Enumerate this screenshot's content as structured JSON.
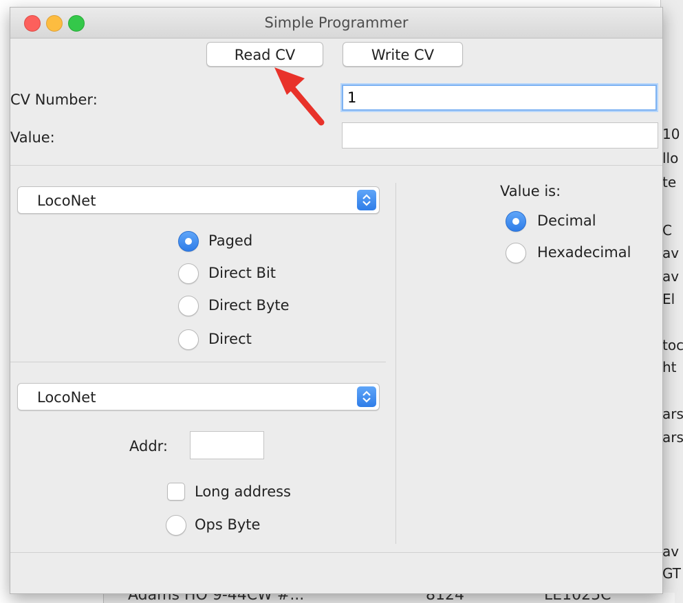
{
  "window": {
    "title": "Simple Programmer"
  },
  "toolbar": {
    "read_cv_label": "Read CV",
    "write_cv_label": "Write CV"
  },
  "cv_number": {
    "label": "CV Number:",
    "value": "1"
  },
  "value_field": {
    "label": "Value:",
    "value": ""
  },
  "programmer_select": {
    "selected": "LocoNet"
  },
  "programming_modes": [
    {
      "label": "Paged",
      "selected": true
    },
    {
      "label": "Direct Bit",
      "selected": false
    },
    {
      "label": "Direct Byte",
      "selected": false
    },
    {
      "label": "Direct",
      "selected": false
    }
  ],
  "ops_select": {
    "selected": "LocoNet"
  },
  "addr": {
    "label": "Addr:",
    "value": ""
  },
  "long_address": {
    "label": "Long address",
    "checked": false
  },
  "ops_byte": {
    "label": "Ops Byte",
    "selected": false
  },
  "value_format": {
    "label": "Value is:",
    "options": [
      {
        "label": "Decimal",
        "selected": true
      },
      {
        "label": "Hexadecimal",
        "selected": false
      }
    ]
  },
  "background_window": {
    "side_fragments": [
      "10",
      "llo",
      "te",
      "C",
      "av",
      "av",
      "El",
      "toc",
      "ht",
      "ars",
      "ars",
      "av",
      "GT"
    ],
    "bottom_row": [
      "Adams HO 9-44CW #...",
      "8124",
      "LE1025C"
    ]
  },
  "colors": {
    "accent": "#3a8ef0",
    "annotation_arrow": "#e8322a"
  }
}
